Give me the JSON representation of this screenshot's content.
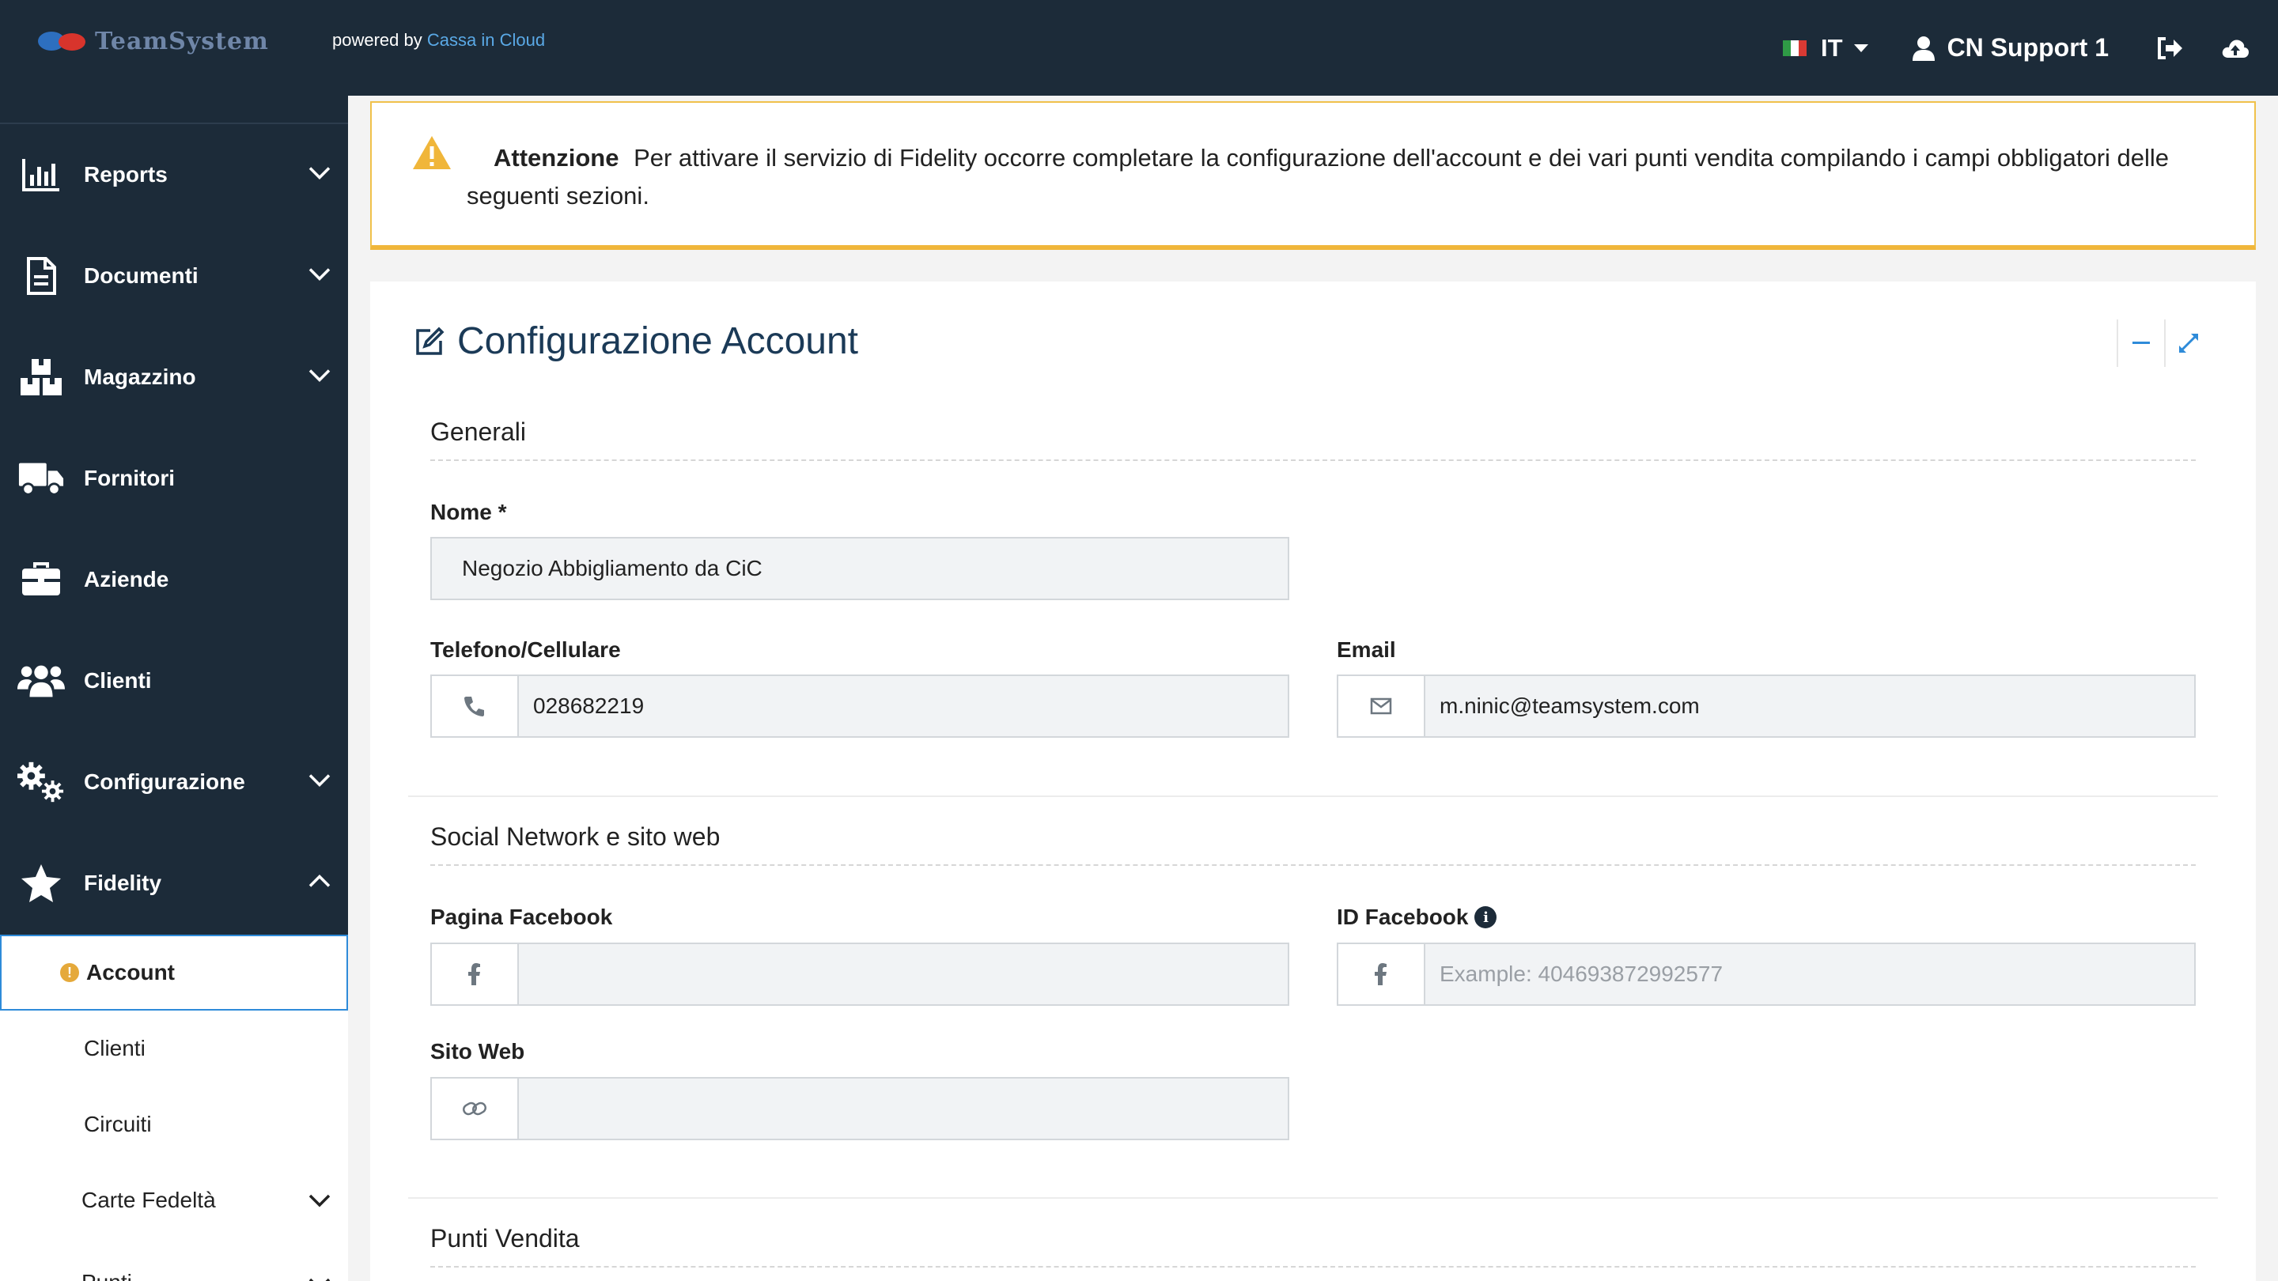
{
  "header": {
    "logo_text": "TeamSystem",
    "powered_by_prefix": "powered by",
    "powered_by_link": "Cassa in Cloud",
    "language": "IT",
    "user_name": "CN Support 1",
    "colors": {
      "bar": "#1c2b39",
      "link": "#5aa9e6"
    }
  },
  "sidebar": {
    "items": [
      {
        "label": "Reports",
        "icon": "bar-chart-icon",
        "expandable": true
      },
      {
        "label": "Documenti",
        "icon": "document-icon",
        "expandable": true
      },
      {
        "label": "Magazzino",
        "icon": "boxes-icon",
        "expandable": true
      },
      {
        "label": "Fornitori",
        "icon": "truck-icon",
        "expandable": false
      },
      {
        "label": "Aziende",
        "icon": "briefcase-icon",
        "expandable": false
      },
      {
        "label": "Clienti",
        "icon": "users-icon",
        "expandable": false
      },
      {
        "label": "Configurazione",
        "icon": "gears-icon",
        "expandable": true
      },
      {
        "label": "Fidelity",
        "icon": "star-icon",
        "expandable": true,
        "expanded": true
      }
    ],
    "fidelity_sub": [
      {
        "label": "Account",
        "active": true,
        "badge": "!"
      },
      {
        "label": "Clienti"
      },
      {
        "label": "Circuiti"
      },
      {
        "label": "Carte Fedeltà",
        "expandable": true
      },
      {
        "label": "Punti",
        "expandable": true
      }
    ]
  },
  "alert": {
    "title": "Attenzione",
    "message": "Per attivare il servizio di Fidelity occorre completare la configurazione dell'account e dei vari punti vendita compilando i campi obbligatori delle seguenti sezioni.",
    "color": "#f0b63a"
  },
  "panel": {
    "title": "Configurazione Account",
    "sections": {
      "generali": "Generali",
      "social": "Social Network e sito web",
      "punti": "Punti Vendita"
    },
    "fields": {
      "nome": {
        "label": "Nome *",
        "value": "Negozio Abbigliamento da CiC"
      },
      "telefono": {
        "label": "Telefono/Cellulare",
        "value": "028682219"
      },
      "email": {
        "label": "Email",
        "value": "m.ninic@teamsystem.com"
      },
      "facebook_page": {
        "label": "Pagina Facebook",
        "value": ""
      },
      "facebook_id": {
        "label": "ID Facebook",
        "value": "",
        "placeholder": "Example: 404693872992577"
      },
      "sito_web": {
        "label": "Sito Web",
        "value": ""
      }
    }
  }
}
